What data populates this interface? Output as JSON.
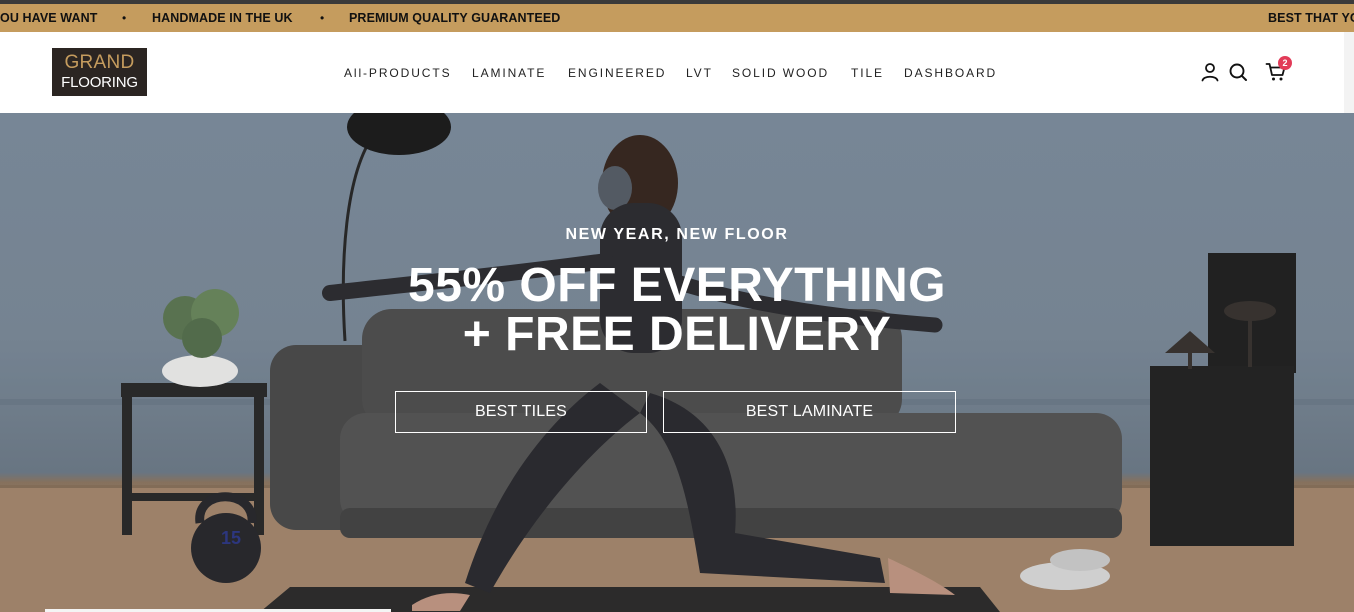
{
  "announcement": {
    "messages": [
      "OU HAVE WANT",
      "HANDMADE IN THE UK",
      "PREMIUM QUALITY GUARANTEED",
      "BEST THAT YO"
    ],
    "separator": "•"
  },
  "brand": {
    "line1": "GRAND",
    "line2": "FLOORING"
  },
  "nav": {
    "items": [
      {
        "label": "All-PRODUCTS"
      },
      {
        "label": "LAMINATE"
      },
      {
        "label": "ENGINEERED"
      },
      {
        "label": "LVT"
      },
      {
        "label": "SOLID WOOD"
      },
      {
        "label": "TILE"
      },
      {
        "label": "DASHBOARD"
      }
    ]
  },
  "header_icons": {
    "account": "user-icon",
    "search": "search-icon",
    "cart": "cart-icon",
    "cart_count": "2"
  },
  "hero": {
    "eyebrow": "NEW YEAR, NEW FLOOR",
    "headline_line1": "55% OFF EVERYTHING",
    "headline_line2": "+ FREE DELIVERY",
    "buttons": [
      {
        "label": "BEST TILES"
      },
      {
        "label": "BEST LAMINATE"
      }
    ],
    "kettlebell_label": "15"
  },
  "colors": {
    "announcement_bg": "#c59c5e",
    "logo_bg": "#2b2522",
    "logo_accent": "#c59c5e",
    "badge": "#e23b58"
  }
}
